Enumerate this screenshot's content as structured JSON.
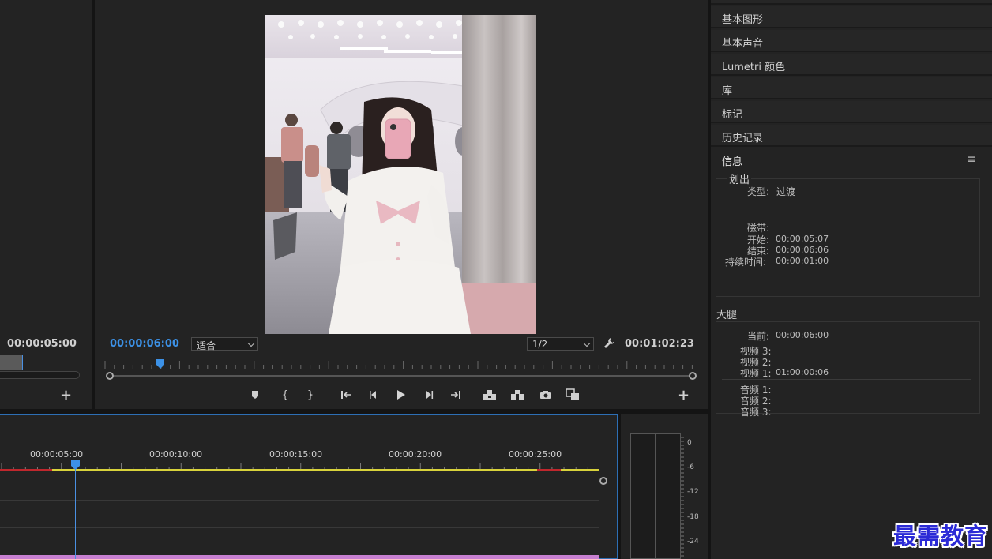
{
  "source_monitor": {
    "timecode": "00:00:05:00"
  },
  "program_monitor": {
    "current_timecode": "00:00:06:00",
    "fit_select": "适合",
    "resolution_select": "1/2",
    "duration_timecode": "00:01:02:23",
    "playhead_position": 0.09,
    "accent_color": "#3c91e6"
  },
  "transport_icons": [
    "add-marker-icon",
    "mark-in-icon",
    "mark-out-icon",
    "go-to-in-icon",
    "step-back-icon",
    "play-icon",
    "step-forward-icon",
    "go-to-out-icon",
    "lift-icon",
    "extract-icon",
    "export-frame-icon",
    "compare-icon"
  ],
  "right_panel": {
    "items": [
      {
        "label": "基本图形"
      },
      {
        "label": "基本声音"
      },
      {
        "label": "Lumetri 颜色"
      },
      {
        "label": "库"
      },
      {
        "label": "标记"
      },
      {
        "label": "历史记录"
      }
    ],
    "info": {
      "title": "信息",
      "clip_name": "划出",
      "type_label": "类型:",
      "type_value": "过渡",
      "tape_label": "磁带:",
      "start_label": "开始:",
      "start_value": "00:00:05:07",
      "end_label": "结束:",
      "end_value": "00:00:06:06",
      "duration_label": "持续时间:",
      "duration_value": "00:00:01:00",
      "sequence_name": "大腿",
      "current_label": "当前:",
      "current_value": "00:00:06:00",
      "video3_label": "视频 3:",
      "video2_label": "视频 2:",
      "video1_label": "视频 1:",
      "video1_value": "01:00:00:06",
      "audio1_label": "音频 1:",
      "audio2_label": "音频 2:",
      "audio3_label": "音频 3:"
    }
  },
  "timeline": {
    "ruler_times": [
      "00:00:05:00",
      "00:00:10:00",
      "00:00:15:00",
      "00:00:20:00",
      "00:00:25:00"
    ],
    "workbar_color": "#d8d23b",
    "clip_color": "#c77fd0"
  },
  "audio_meter": {
    "labels": [
      "0",
      "-6",
      "-12",
      "-18",
      "-24"
    ]
  },
  "watermark": "最需教育"
}
